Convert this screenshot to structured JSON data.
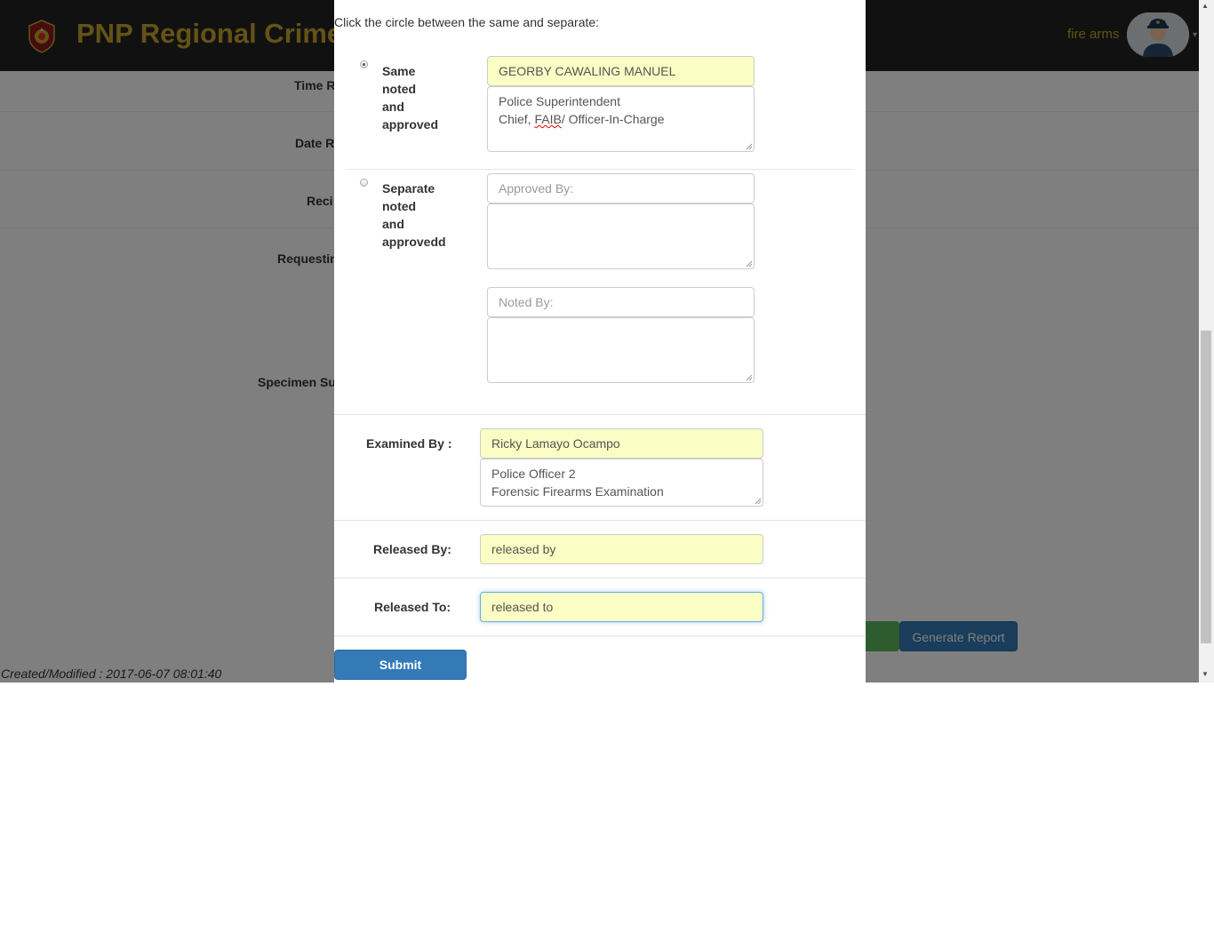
{
  "header": {
    "title": "PNP Regional Crime",
    "nav_link": "fire arms",
    "avatar": "police-officer-avatar"
  },
  "background_form": {
    "labels": [
      "Time R",
      "Date R",
      "Reci",
      "Requestin",
      "Specimen Su"
    ],
    "generate_report_label": "Generate Report",
    "footer": "Created/Modified : 2017-06-07 08:01:40"
  },
  "modal": {
    "instruction": "Click the circle between the same and separate:",
    "same_option": {
      "label_lines": [
        "Same",
        "noted",
        "and",
        "approved"
      ],
      "checked": true,
      "name_value": "GEORBY CAWALING MANUEL",
      "position_lines": [
        "Police Superintendent",
        "Chief, ",
        "FAIB",
        "/ Officer-In-Charge"
      ]
    },
    "separate_option": {
      "label_lines": [
        "Separate",
        "noted",
        "and",
        "approvedd"
      ],
      "checked": false,
      "approved_by_placeholder": "Approved By:",
      "noted_by_placeholder": "Noted By:"
    },
    "examined_by": {
      "label": "Examined By :",
      "name_value": "Ricky Lamayo Ocampo",
      "position_lines": [
        "Police Officer 2",
        "Forensic Firearms Examination"
      ]
    },
    "released_by": {
      "label": "Released By:",
      "value": "released by"
    },
    "released_to": {
      "label": "Released To:",
      "value": "released to"
    },
    "submit_label": "Submit"
  },
  "colors": {
    "topbar": "#222222",
    "brand_gold": "#c8a52d",
    "primary_button": "#337ab7",
    "success_button": "#5cb85c",
    "autofill_yellow": "#fafdc4"
  }
}
